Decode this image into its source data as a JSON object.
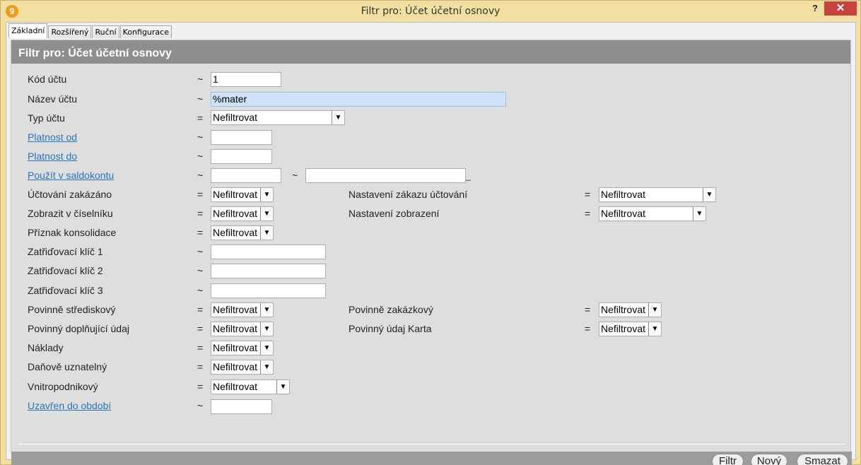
{
  "window": {
    "title": "Filtr pro: Účet účetní osnovy",
    "help_label": "?",
    "close_label": "✕"
  },
  "tabs": [
    {
      "label": "Základní",
      "active": true
    },
    {
      "label": "Rozšířený",
      "active": false
    },
    {
      "label": "Ruční",
      "active": false
    },
    {
      "label": "Konfigurace",
      "active": false
    }
  ],
  "panel": {
    "title": "Filtr pro: Účet účetní osnovy"
  },
  "fields": {
    "kod_uctu": {
      "label": "Kód účtu",
      "op": "~",
      "value": "1"
    },
    "nazev_uctu": {
      "label": "Název účtu",
      "op": "~",
      "value": "%mater"
    },
    "typ_uctu": {
      "label": "Typ účtu",
      "op": "=",
      "value": "Nefiltrovat"
    },
    "platnost_od": {
      "label": "Platnost od",
      "op": "~",
      "value": ""
    },
    "platnost_do": {
      "label": "Platnost do",
      "op": "~",
      "value": ""
    },
    "pouzit_v_saldokontu": {
      "label": "Použít v saldokontu",
      "op": "~",
      "value": "",
      "op2": "~",
      "value2": "",
      "trailing": "_"
    },
    "uctovani_zakazano": {
      "label": "Účtování zakázáno",
      "op": "=",
      "value": "Nefiltrovat"
    },
    "nastaveni_zakazu": {
      "label": "Nastavení zákazu účtování",
      "op": "=",
      "value": "Nefiltrovat"
    },
    "zobrazit_v_ciselniku": {
      "label": "Zobrazit v číselníku",
      "op": "=",
      "value": "Nefiltrovat"
    },
    "nastaveni_zobrazeni": {
      "label": "Nastavení zobrazení",
      "op": "=",
      "value": "Nefiltrovat"
    },
    "priznak_konsolidace": {
      "label": "Příznak konsolidace",
      "op": "=",
      "value": "Nefiltrovat"
    },
    "zatridovaci_klic_1": {
      "label": "Zatřiďovací klíč 1",
      "op": "~",
      "value": ""
    },
    "zatridovaci_klic_2": {
      "label": "Zatřiďovací klíč 2",
      "op": "~",
      "value": ""
    },
    "zatridovaci_klic_3": {
      "label": "Zatřiďovací klíč 3",
      "op": "~",
      "value": ""
    },
    "povinne_strediskovy": {
      "label": "Povinně střediskový",
      "op": "=",
      "value": "Nefiltrovat"
    },
    "povinne_zakazkovy": {
      "label": "Povinně zakázkový",
      "op": "=",
      "value": "Nefiltrovat"
    },
    "povinny_doplnujici_udaj": {
      "label": "Povinný doplňující údaj",
      "op": "=",
      "value": "Nefiltrovat"
    },
    "povinny_udaj_karta": {
      "label": "Povinný údaj Karta",
      "op": "=",
      "value": "Nefiltrovat"
    },
    "naklady": {
      "label": "Náklady",
      "op": "=",
      "value": "Nefiltrovat"
    },
    "danove_uznatelny": {
      "label": "Daňově uznatelný",
      "op": "=",
      "value": "Nefiltrovat"
    },
    "vnitropodnikovy": {
      "label": "Vnitropodnikový",
      "op": "=",
      "value": "Nefiltrovat"
    },
    "uzavren_do_obdobi": {
      "label": "Uzavřen do období",
      "op": "~",
      "value": ""
    }
  },
  "buttons": {
    "filter": "Filtr",
    "new": "Nový",
    "clear": "Smazat"
  }
}
